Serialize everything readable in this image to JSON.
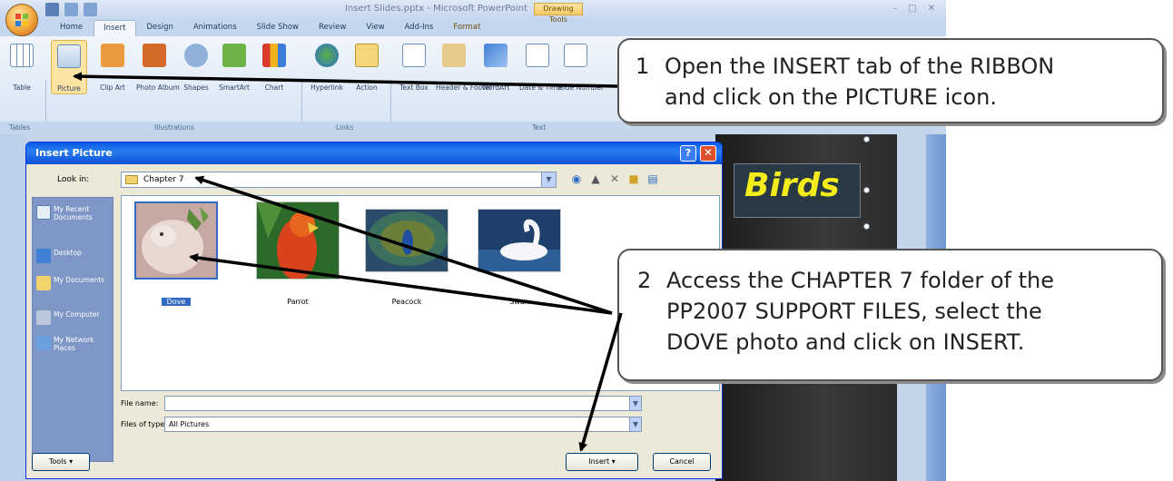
{
  "app": {
    "title": "Insert Slides.pptx - Microsoft PowerPoint",
    "context_tab_group": "Drawing Tools",
    "tabs": [
      {
        "label": "Home"
      },
      {
        "label": "Insert"
      },
      {
        "label": "Design"
      },
      {
        "label": "Animations"
      },
      {
        "label": "Slide Show"
      },
      {
        "label": "Review"
      },
      {
        "label": "View"
      },
      {
        "label": "Add-Ins"
      },
      {
        "label": "Format"
      }
    ]
  },
  "ribbon": {
    "items": [
      {
        "label": "Table"
      },
      {
        "label": "Picture"
      },
      {
        "label": "Clip Art"
      },
      {
        "label": "Photo Album"
      },
      {
        "label": "Shapes"
      },
      {
        "label": "SmartArt"
      },
      {
        "label": "Chart"
      },
      {
        "label": "Hyperlink"
      },
      {
        "label": "Action"
      },
      {
        "label": "Text Box"
      },
      {
        "label": "Header & Footer"
      },
      {
        "label": "WordArt"
      },
      {
        "label": "Date & Time"
      },
      {
        "label": "Slide Number"
      }
    ],
    "groups": [
      {
        "label": "Tables"
      },
      {
        "label": "Illustrations"
      },
      {
        "label": "Links"
      },
      {
        "label": "Text"
      }
    ]
  },
  "slide": {
    "title": "Birds"
  },
  "dialog": {
    "title": "Insert Picture",
    "help": "?",
    "close": "✕",
    "look_in_label": "Look in:",
    "look_in_value": "Chapter 7",
    "places": [
      {
        "label": "My Recent Documents"
      },
      {
        "label": "Desktop"
      },
      {
        "label": "My Documents"
      },
      {
        "label": "My Computer"
      },
      {
        "label": "My Network Places"
      }
    ],
    "files": [
      {
        "name": "Dove"
      },
      {
        "name": "Parrot"
      },
      {
        "name": "Peacock"
      },
      {
        "name": "Swan"
      }
    ],
    "file_name_label": "File name:",
    "file_name_value": "",
    "files_of_type_label": "Files of type:",
    "files_of_type_value": "All Pictures",
    "tools_label": "Tools",
    "insert_label": "Insert",
    "cancel_label": "Cancel"
  },
  "callouts": {
    "step1": {
      "number": "1",
      "line1": "Open the INSERT tab of the RIBBON",
      "line2": "and click on the PICTURE icon."
    },
    "step2": {
      "number": "2",
      "line1": "Access the CHAPTER 7 folder of the",
      "line2": "PP2007 SUPPORT FILES, select the",
      "line3": "DOVE photo and click on INSERT."
    }
  },
  "colors": {
    "dialog_titlebar": "#0a5ae6",
    "selection": "#316ac5",
    "slide_title": "#f5ec1b",
    "arrow": "#000000"
  }
}
